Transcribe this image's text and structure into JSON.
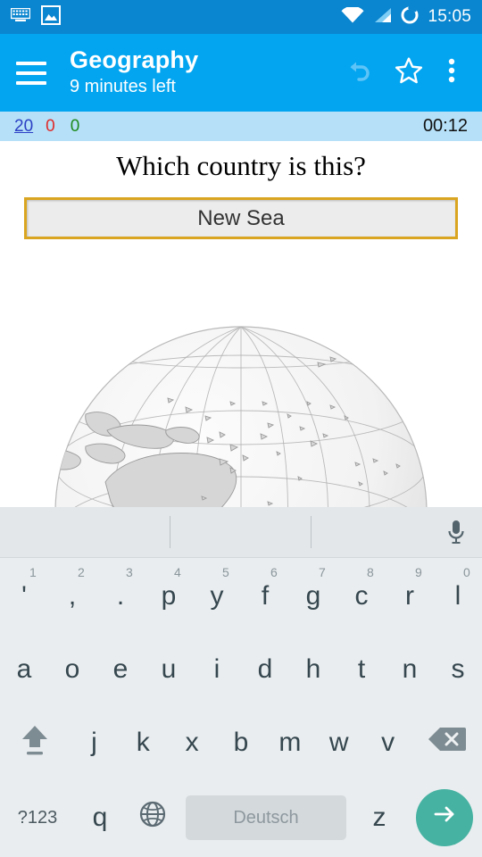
{
  "statusbar": {
    "time": "15:05",
    "icons": [
      "keyboard-icon",
      "image-icon",
      "wifi-icon",
      "signal-icon",
      "sync-circle-icon"
    ]
  },
  "appbar": {
    "menu_icon": "hamburger-menu-icon",
    "title": "Geography",
    "subtitle": "9 minutes left",
    "undo_icon": "undo-icon",
    "star_icon": "star-outline-icon",
    "overflow_icon": "overflow-menu-icon"
  },
  "scorebar": {
    "remaining": "20",
    "wrong": "0",
    "correct": "0",
    "timer": "00:12"
  },
  "quiz": {
    "question": "Which country is this?",
    "answer_value": "New Sea",
    "answer_placeholder": "",
    "image_name": "globe-oceania-new-zealand"
  },
  "keyboard": {
    "mic_icon": "microphone-icon",
    "suggestions": [
      "",
      "",
      ""
    ],
    "row1": [
      {
        "label": "'",
        "hint": "1"
      },
      {
        "label": ",",
        "hint": "2"
      },
      {
        "label": ".",
        "hint": "3"
      },
      {
        "label": "p",
        "hint": "4"
      },
      {
        "label": "y",
        "hint": "5"
      },
      {
        "label": "f",
        "hint": "6"
      },
      {
        "label": "g",
        "hint": "7"
      },
      {
        "label": "c",
        "hint": "8"
      },
      {
        "label": "r",
        "hint": "9"
      },
      {
        "label": "l",
        "hint": "0"
      }
    ],
    "row2": [
      "a",
      "o",
      "e",
      "u",
      "i",
      "d",
      "h",
      "t",
      "n",
      "s"
    ],
    "row3": [
      "j",
      "k",
      "x",
      "b",
      "m",
      "w",
      "v"
    ],
    "shift_icon": "shift-icon",
    "backspace_icon": "backspace-icon",
    "symbols_label": "?123",
    "q_label": "q",
    "globe_icon": "language-globe-icon",
    "space_label": "Deutsch",
    "z_label": "z",
    "enter_icon": "enter-arrow-icon"
  },
  "colors": {
    "statusbar_bg": "#0a85cf",
    "appbar_bg": "#03a5f0",
    "scorebar_bg": "#b5e0f7",
    "answer_border": "#daa520",
    "enter_button": "#46b2a2",
    "remaining_text": "#2b3fc4",
    "wrong_text": "#e02b2b",
    "correct_text": "#1d8a1d",
    "nz_highlight": "#3a7a33"
  }
}
